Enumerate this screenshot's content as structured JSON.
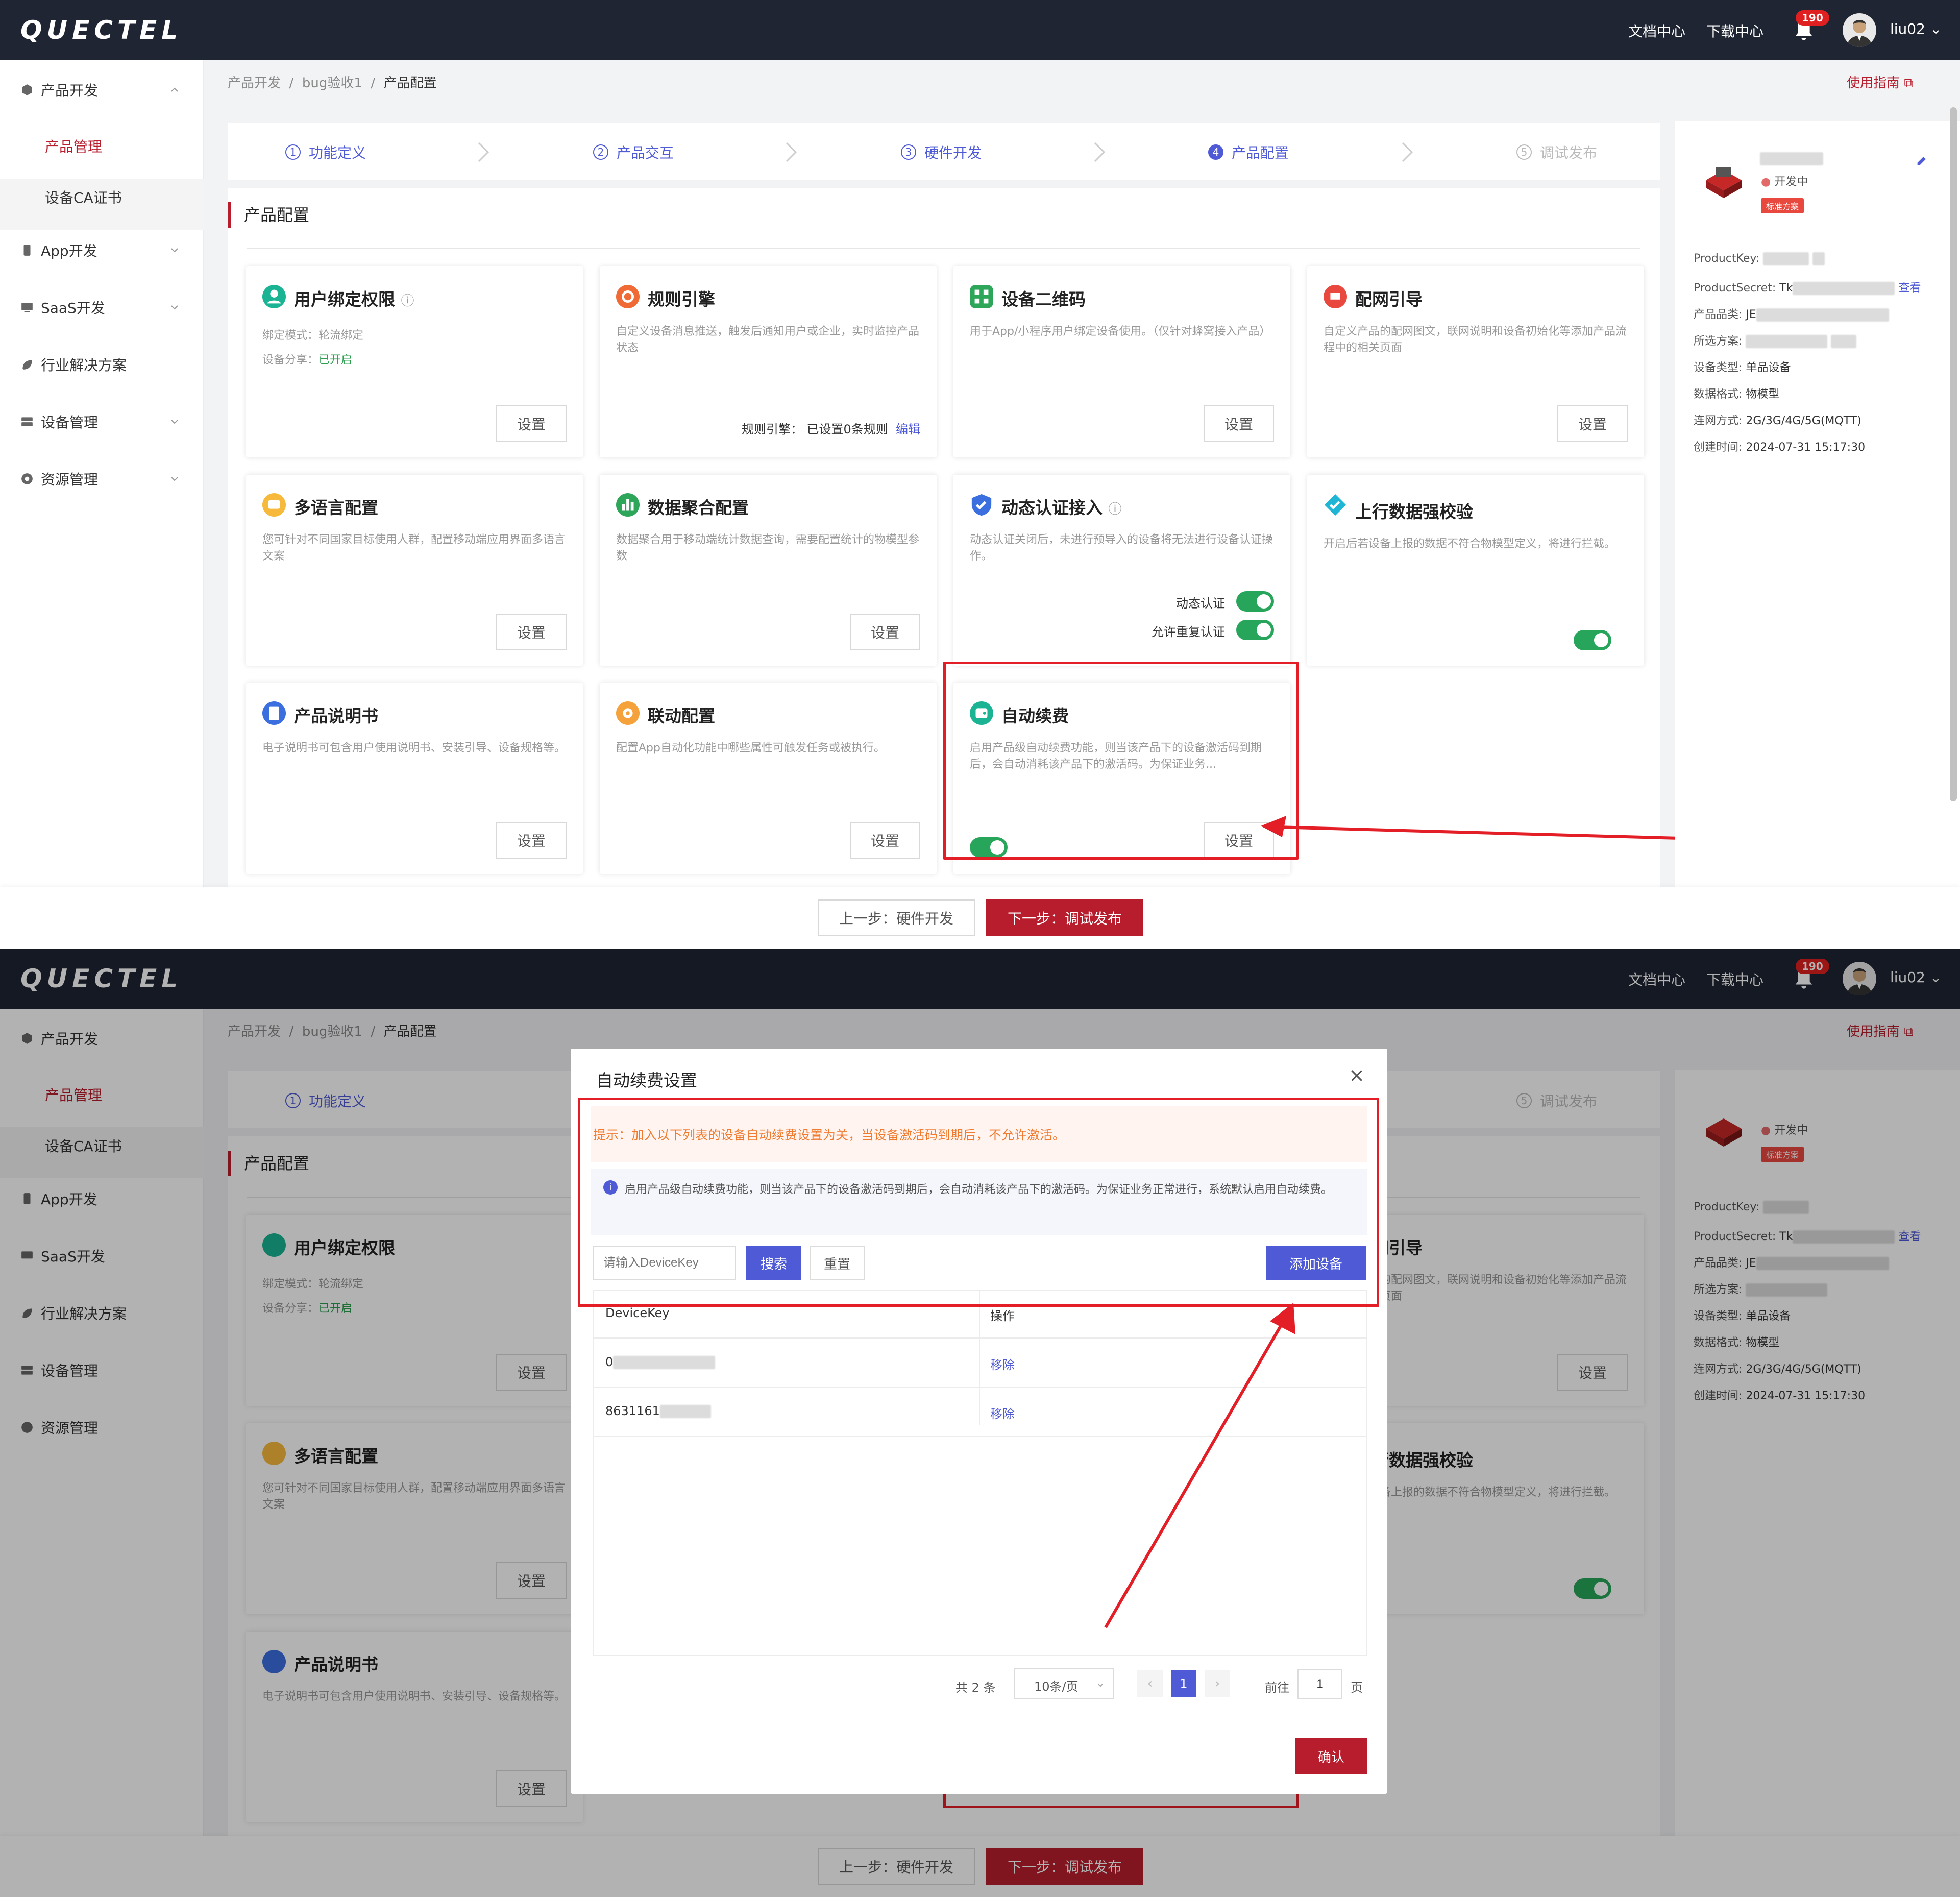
{
  "header": {
    "logo": "QUECTEL",
    "docs_link": "文档中心",
    "download_link": "下载中心",
    "notification_count": "190",
    "username": "liu02"
  },
  "sidebar": {
    "items": [
      {
        "label": "产品开发",
        "expanded": true
      },
      {
        "label": "App开发"
      },
      {
        "label": "SaaS开发"
      },
      {
        "label": "行业解决方案"
      },
      {
        "label": "设备管理"
      },
      {
        "label": "资源管理"
      }
    ],
    "sub_items": [
      {
        "label": "产品管理",
        "active": true
      },
      {
        "label": "设备CA证书"
      }
    ]
  },
  "breadcrumb": {
    "l1": "产品开发",
    "l2": "bug验收1",
    "l3": "产品配置",
    "sep": "/"
  },
  "guide_link": "使用指南",
  "steps": [
    {
      "num": "1",
      "label": "功能定义"
    },
    {
      "num": "2",
      "label": "产品交互"
    },
    {
      "num": "3",
      "label": "硬件开发"
    },
    {
      "num": "4",
      "label": "产品配置",
      "current": true
    },
    {
      "num": "5",
      "label": "调试发布",
      "disabled": true
    }
  ],
  "section_title": "产品配置",
  "cards": {
    "user_binding": {
      "title": "用户绑定权限",
      "mode_label": "绑定模式：",
      "mode_value": "轮流绑定",
      "share_label": "设备分享：",
      "share_value": "已开启",
      "button": "设置"
    },
    "rule_engine": {
      "title": "规则引擎",
      "desc": "自定义设备消息推送，触发后通知用户或企业，实时监控产品状态",
      "status": "规则引擎：  已设置0条规则",
      "edit": "编辑"
    },
    "qrcode": {
      "title": "设备二维码",
      "desc": "用于App/小程序用户绑定设备使用。（仅针对蜂窝接入产品）",
      "button": "设置"
    },
    "network_guide": {
      "title": "配网引导",
      "desc": "自定义产品的配网图文，联网说明和设备初始化等添加产品流程中的相关页面",
      "button": "设置"
    },
    "multi_language": {
      "title": "多语言配置",
      "desc": "您可针对不同国家目标使用人群，配置移动端应用界面多语言文案",
      "button": "设置"
    },
    "data_aggregation": {
      "title": "数据聚合配置",
      "desc": "数据聚合用于移动端统计数据查询，需要配置统计的物模型参数",
      "button": "设置"
    },
    "dynamic_auth": {
      "title": "动态认证接入",
      "desc": "动态认证关闭后，未进行预导入的设备将无法进行设备认证操作。",
      "toggle1": "动态认证",
      "toggle2": "允许重复认证"
    },
    "upstream_check": {
      "title": "上行数据强校验",
      "desc": "开启后若设备上报的数据不符合物模型定义，将进行拦截。"
    },
    "manual": {
      "title": "产品说明书",
      "desc": "电子说明书可包含用户使用说明书、安装引导、设备规格等。",
      "button": "设置"
    },
    "linkage": {
      "title": "联动配置",
      "desc": "配置App自动化功能中哪些属性可触发任务或被执行。",
      "button": "设置"
    },
    "auto_renew": {
      "title": "自动续费",
      "desc": "启用产品级自动续费功能，则当该产品下的设备激活码到期后，会自动消耗该产品下的激活码。为保证业务...",
      "button": "设置"
    }
  },
  "product_info": {
    "status": "开发中",
    "tag": "标准方案",
    "rows": [
      {
        "label": "ProductKey:",
        "value": ""
      },
      {
        "label": "ProductSecret:",
        "value": "Tk",
        "link": "查看"
      },
      {
        "label": "产品品类:",
        "value": "JE"
      },
      {
        "label": "所选方案:",
        "value": ""
      },
      {
        "label": "设备类型:",
        "value": "单品设备"
      },
      {
        "label": "数据格式:",
        "value": "物模型"
      },
      {
        "label": "连网方式:",
        "value": "2G/3G/4G/5G(MQTT)"
      },
      {
        "label": "创建时间:",
        "value": "2024-07-31 15:17:30"
      }
    ]
  },
  "footer": {
    "prev": "上一步：硬件开发",
    "next": "下一步：调试发布"
  },
  "modal": {
    "title": "自动续费设置",
    "warning": "提示：加入以下列表的设备自动续费设置为关，当设备激活码到期后，不允许激活。",
    "info": "启用产品级自动续费功能，则当该产品下的设备激活码到期后，会自动消耗该产品下的激活码。为保证业务正常进行，系统默认启用自动续费。",
    "search_placeholder": "请输入DeviceKey",
    "search_button": "搜索",
    "reset_button": "重置",
    "add_button": "添加设备",
    "columns": [
      "DeviceKey",
      "操作"
    ],
    "rows": [
      {
        "key": "0",
        "action": "移除"
      },
      {
        "key": "8631161",
        "action": "移除"
      }
    ],
    "pagination": {
      "total": "共 2 条",
      "page_size": "10条/页",
      "current": "1",
      "goto_label": "前往",
      "goto_value": "1",
      "page_suffix": "页"
    },
    "confirm_button": "确认"
  },
  "colors": {
    "brand": "#b81d2d",
    "accent": "#4f5ad6",
    "success": "#27a55a",
    "header_bg": "#1f2533"
  }
}
